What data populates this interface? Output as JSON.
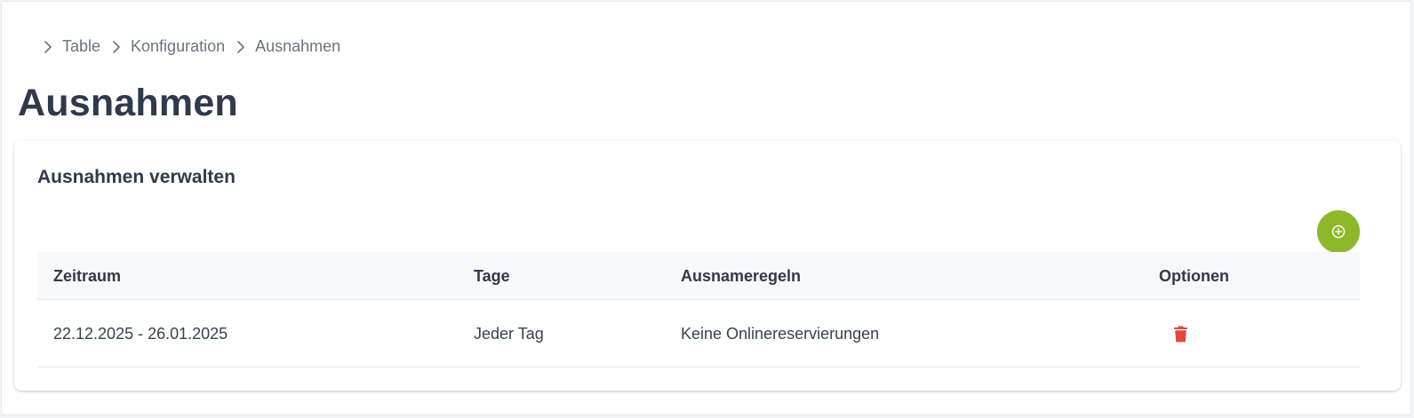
{
  "breadcrumb": {
    "items": [
      {
        "label": "Table"
      },
      {
        "label": "Konfiguration"
      },
      {
        "label": "Ausnahmen"
      }
    ]
  },
  "page": {
    "title": "Ausnahmen"
  },
  "card": {
    "title": "Ausnahmen verwalten",
    "add_button_icon": "plus-circle-icon"
  },
  "table": {
    "columns": [
      "Zeitraum",
      "Tage",
      "Ausnameregeln",
      "Optionen"
    ],
    "rows": [
      {
        "zeitraum": "22.12.2025 - 26.01.2025",
        "tage": "Jeder Tag",
        "regeln": "Keine Onlinereservierungen",
        "option_icon": "trash-icon"
      }
    ]
  },
  "colors": {
    "accent_green": "#8db82a",
    "delete_red": "#e3483e",
    "title_text": "#2f3a4c",
    "muted_text": "#6b7280"
  }
}
